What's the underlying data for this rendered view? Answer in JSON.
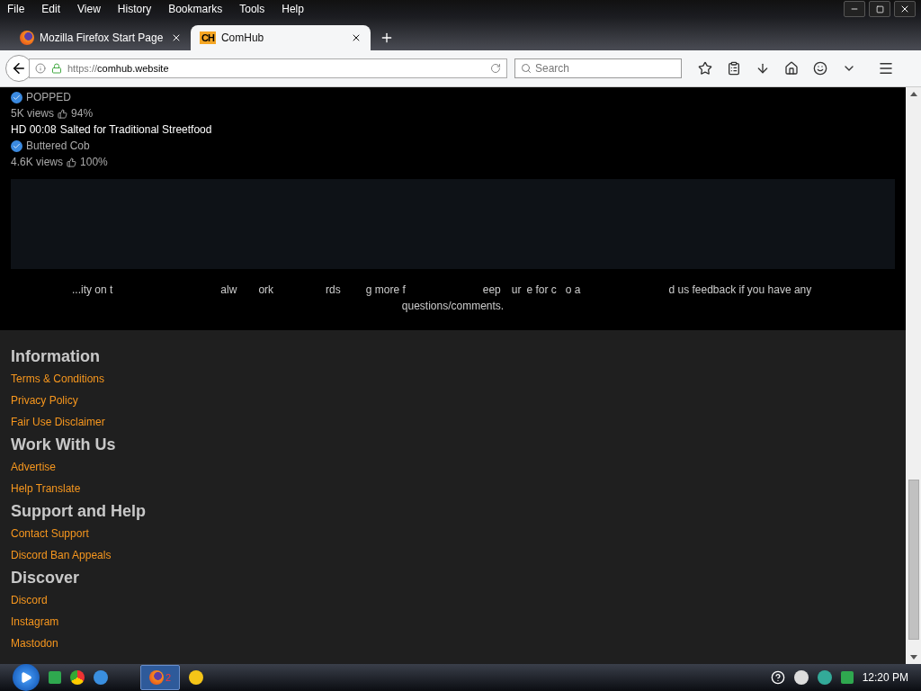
{
  "menu": [
    "File",
    "Edit",
    "View",
    "History",
    "Bookmarks",
    "Tools",
    "Help"
  ],
  "tabs": [
    {
      "title": "Mozilla Firefox Start Page",
      "selected": false
    },
    {
      "title": "ComHub",
      "logo": "CH",
      "selected": true
    }
  ],
  "address": {
    "scheme": "https://",
    "host": "comhub.website"
  },
  "search": {
    "placeholder": "Search"
  },
  "videos": [
    {
      "channel": "POPPED",
      "stats": "5K views",
      "rating": "94%"
    },
    {
      "overlay": "HD 00:08",
      "title": "Salted for Traditional Streetfood",
      "channel": "Buttered Cob",
      "stats": "4.6K views",
      "rating": "100%"
    }
  ],
  "notice": {
    "fragments": [
      "...ity on t",
      "alw",
      "ork",
      "rds",
      "g more f",
      "eep",
      "ur",
      "e for c",
      "o a",
      "d us feedback if you have any"
    ],
    "last_line": "questions/comments."
  },
  "footer": [
    {
      "heading": "Information",
      "links": [
        "Terms & Conditions",
        "Privacy Policy",
        "Fair Use Disclaimer"
      ]
    },
    {
      "heading": "Work With Us",
      "links": [
        "Advertise",
        "Help Translate"
      ]
    },
    {
      "heading": "Support and Help",
      "links": [
        "Contact Support",
        "Discord Ban Appeals"
      ]
    },
    {
      "heading": "Discover",
      "links": [
        "Discord",
        "Instagram",
        "Mastodon"
      ]
    }
  ],
  "taskbar": {
    "firefox_count": "2",
    "clock": "12:20 PM"
  }
}
